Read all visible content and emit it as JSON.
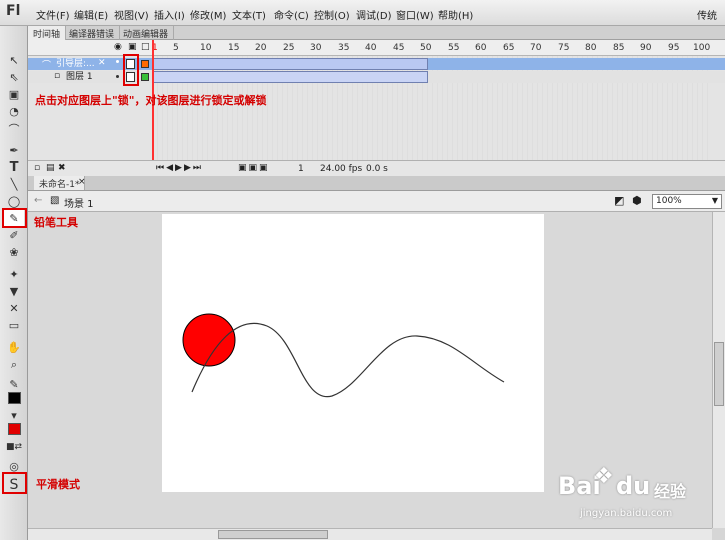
{
  "app": {
    "logo": "Fl",
    "workspace": "传统"
  },
  "menu": [
    "文件(F)",
    "编辑(E)",
    "视图(V)",
    "插入(I)",
    "修改(M)",
    "文本(T)",
    "命令(C)",
    "控制(O)",
    "调试(D)",
    "窗口(W)",
    "帮助(H)"
  ],
  "timeline": {
    "tabs": [
      "时间轴",
      "编译器错误",
      "动画编辑器"
    ],
    "frame_numbers": [
      "1",
      "5",
      "10",
      "15",
      "20",
      "25",
      "30",
      "35",
      "40",
      "45",
      "50",
      "55",
      "60",
      "65",
      "70",
      "75",
      "80",
      "85",
      "90",
      "95",
      "100"
    ],
    "layers": [
      {
        "name": "引导层:...",
        "type": "guide"
      },
      {
        "name": "图层 1",
        "type": "normal"
      }
    ],
    "status": {
      "frame": "1",
      "fps": "24.00 fps",
      "time": "0.0 s"
    }
  },
  "document": {
    "tab": "未命名-1*",
    "scene": "场景 1",
    "zoom": "100%"
  },
  "annotations": {
    "lock": "点击对应图层上\"锁\"，对该图层进行锁定或解锁",
    "pencil": "铅笔工具",
    "smooth": "平滑模式"
  },
  "colors": {
    "circle": "#ff0000",
    "annotation": "#d40000",
    "stroke": "#000000",
    "fill": "#e00000"
  },
  "watermark": {
    "brand": "Bai",
    "brand2": "du",
    "suffix": "经验",
    "url": "jingyan.baidu.com"
  }
}
